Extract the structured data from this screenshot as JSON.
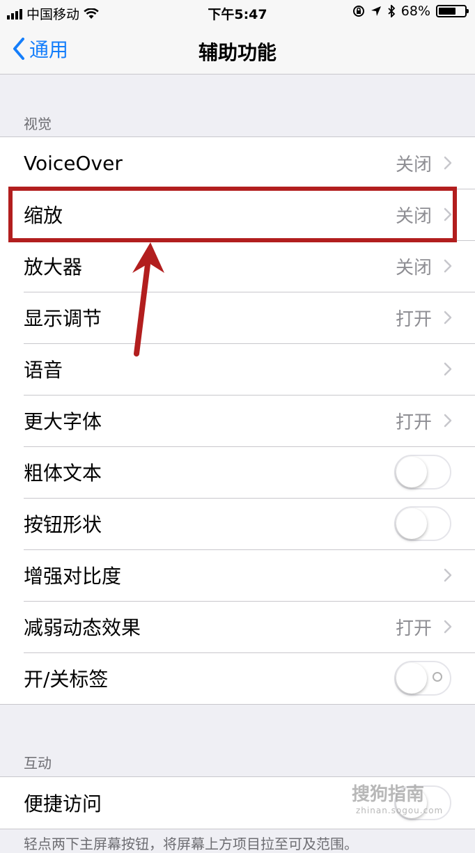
{
  "status_bar": {
    "carrier": "中国移动",
    "time": "下午5:47",
    "battery": "68%",
    "battery_level": 0.68
  },
  "nav": {
    "back_label": "通用",
    "title": "辅助功能"
  },
  "vision": {
    "header": "视觉",
    "rows": [
      {
        "label": "VoiceOver",
        "value": "关闭",
        "control": "chevron"
      },
      {
        "label": "缩放",
        "value": "关闭",
        "control": "chevron"
      },
      {
        "label": "放大器",
        "value": "关闭",
        "control": "chevron"
      },
      {
        "label": "显示调节",
        "value": "打开",
        "control": "chevron"
      },
      {
        "label": "语音",
        "value": "",
        "control": "chevron"
      },
      {
        "label": "更大字体",
        "value": "打开",
        "control": "chevron"
      },
      {
        "label": "粗体文本",
        "control": "toggle",
        "on": false
      },
      {
        "label": "按钮形状",
        "control": "toggle",
        "on": false
      },
      {
        "label": "增强对比度",
        "value": "",
        "control": "chevron"
      },
      {
        "label": "减弱动态效果",
        "value": "打开",
        "control": "chevron"
      },
      {
        "label": "开/关标签",
        "control": "toggle",
        "on": false
      }
    ]
  },
  "interaction": {
    "header": "互动",
    "rows": [
      {
        "label": "便捷访问",
        "control": "toggle",
        "on": false
      }
    ]
  },
  "footer_text": "轻点两下主屏幕按钮，将屏幕上方项目拉至可及范围。",
  "watermark": {
    "main": "搜狗指南",
    "sub": "zhinan.sogou.com"
  },
  "annotation": {
    "highlight_color": "#b21e1e"
  },
  "colors": {
    "accent": "#147efb",
    "background": "#efeff4"
  }
}
